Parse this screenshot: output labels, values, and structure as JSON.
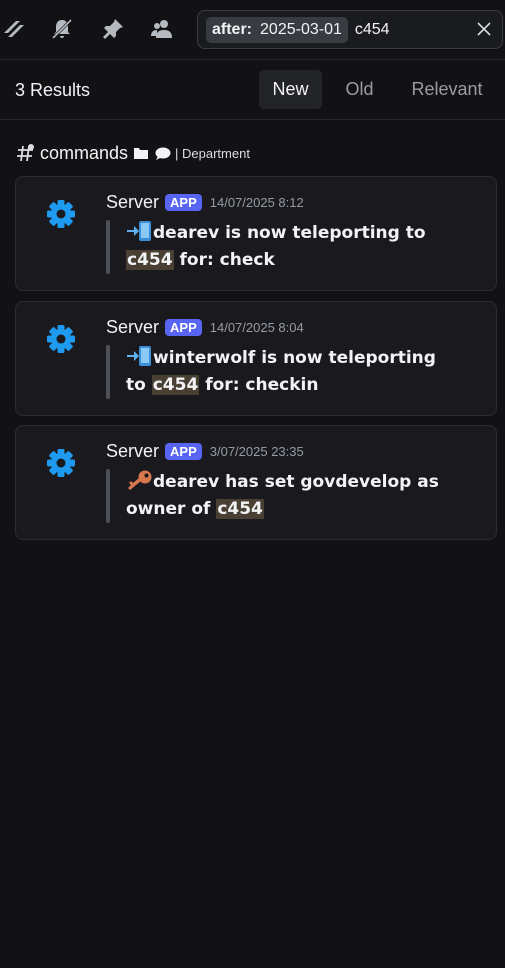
{
  "search": {
    "filter_key": "after:",
    "filter_value": "2025-03-01",
    "query": "c454"
  },
  "results": {
    "count_label": "3 Results",
    "tabs": [
      {
        "label": "New",
        "active": true
      },
      {
        "label": "Old",
        "active": false
      },
      {
        "label": "Relevant",
        "active": false
      }
    ]
  },
  "channel": {
    "name": "commands",
    "department": "| Department"
  },
  "messages": [
    {
      "author": "Server",
      "badge": "APP",
      "time": "14/07/2025 8:12",
      "lines": [
        {
          "icon": "teleport-phone-icon",
          "text": "dearev is now teleporting to"
        },
        {
          "highlight": "c454",
          "text": " for: check"
        }
      ]
    },
    {
      "author": "Server",
      "badge": "APP",
      "time": "14/07/2025 8:04",
      "lines": [
        {
          "icon": "teleport-phone-icon",
          "text": "winterwolf is now teleporting"
        },
        {
          "prefix": "to ",
          "highlight": "c454",
          "text": " for: checkin"
        }
      ]
    },
    {
      "author": "Server",
      "badge": "APP",
      "time": "3/07/2025 23:35",
      "lines": [
        {
          "icon": "key-icon",
          "text": "dearev has set govdevelop as"
        },
        {
          "prefix": "owner of ",
          "highlight": "c454",
          "text": ""
        }
      ]
    }
  ],
  "colors": {
    "background": "#121214",
    "card": "#1a1a1e",
    "accent_badge": "#5865f2",
    "gear": "#1e9bf0",
    "highlight": "#4a3f33"
  }
}
